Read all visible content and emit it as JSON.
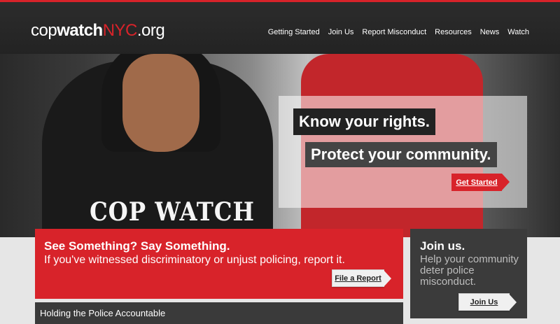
{
  "brand": {
    "logo_prefix": "cop",
    "logo_bold": "watch",
    "logo_city": "NYC",
    "logo_suffix": ".org",
    "accent_color": "#d8232a"
  },
  "nav": {
    "items": [
      {
        "label": "Getting Started"
      },
      {
        "label": "Join Us"
      },
      {
        "label": "Report Misconduct"
      },
      {
        "label": "Resources"
      },
      {
        "label": "News"
      },
      {
        "label": "Watch"
      }
    ]
  },
  "hero": {
    "headline_1": "Know your rights.",
    "headline_2": "Protect your community.",
    "cta_label": "Get Started",
    "shirt_text": "COP WATCH"
  },
  "report": {
    "title": "See Something? Say Something.",
    "subtitle": "If you've witnessed discriminatory or unjust policing, report it.",
    "button_label": "File a Report"
  },
  "join": {
    "title": "Join us.",
    "text": "Help your community deter police misconduct.",
    "button_label": "Join Us"
  },
  "section": {
    "title": "Holding the Police Accountable"
  }
}
